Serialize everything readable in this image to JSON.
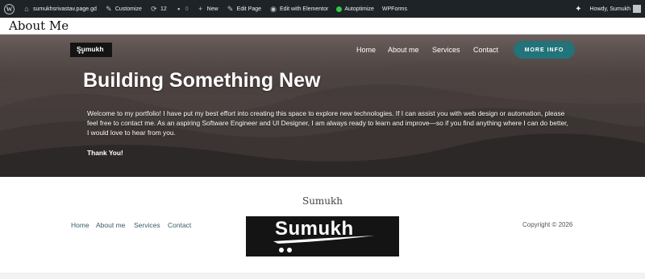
{
  "admin_bar": {
    "site": "sumukhsrivastav.page.gd",
    "customize": "Customize",
    "updates_count": "12",
    "comments_count": "0",
    "new": "New",
    "edit_page": "Edit Page",
    "elementor": "Edit with Elementor",
    "autoptimize": "Autoptimize",
    "wpforms": "WPForms",
    "howdy": "Howdy, Sumukh"
  },
  "page_title": "About Me",
  "hero": {
    "logo_text": "Sumukh",
    "logo_dots": "●●",
    "nav": [
      "Home",
      "About me",
      "Services",
      "Contact"
    ],
    "cta": "MORE INFO",
    "cta_color": "#22737a",
    "heading": "Building Something New",
    "paragraph": "Welcome to my portfolio! I have put my best effort into creating this space to explore new technologies. If I can assist you with web design or automation, please feel free to contact me. As an aspiring Software Engineer and UI Designer, I am always ready to learn and improve—so if you find anything where I can do better, I would love to hear from you.",
    "thanks": "Thank You!"
  },
  "footer": {
    "site_name": "Sumukh",
    "nav": [
      "Home",
      "About me",
      "Services",
      "Contact"
    ],
    "logo_text": "Sumukh",
    "copyright": "Copyright © 2026"
  }
}
